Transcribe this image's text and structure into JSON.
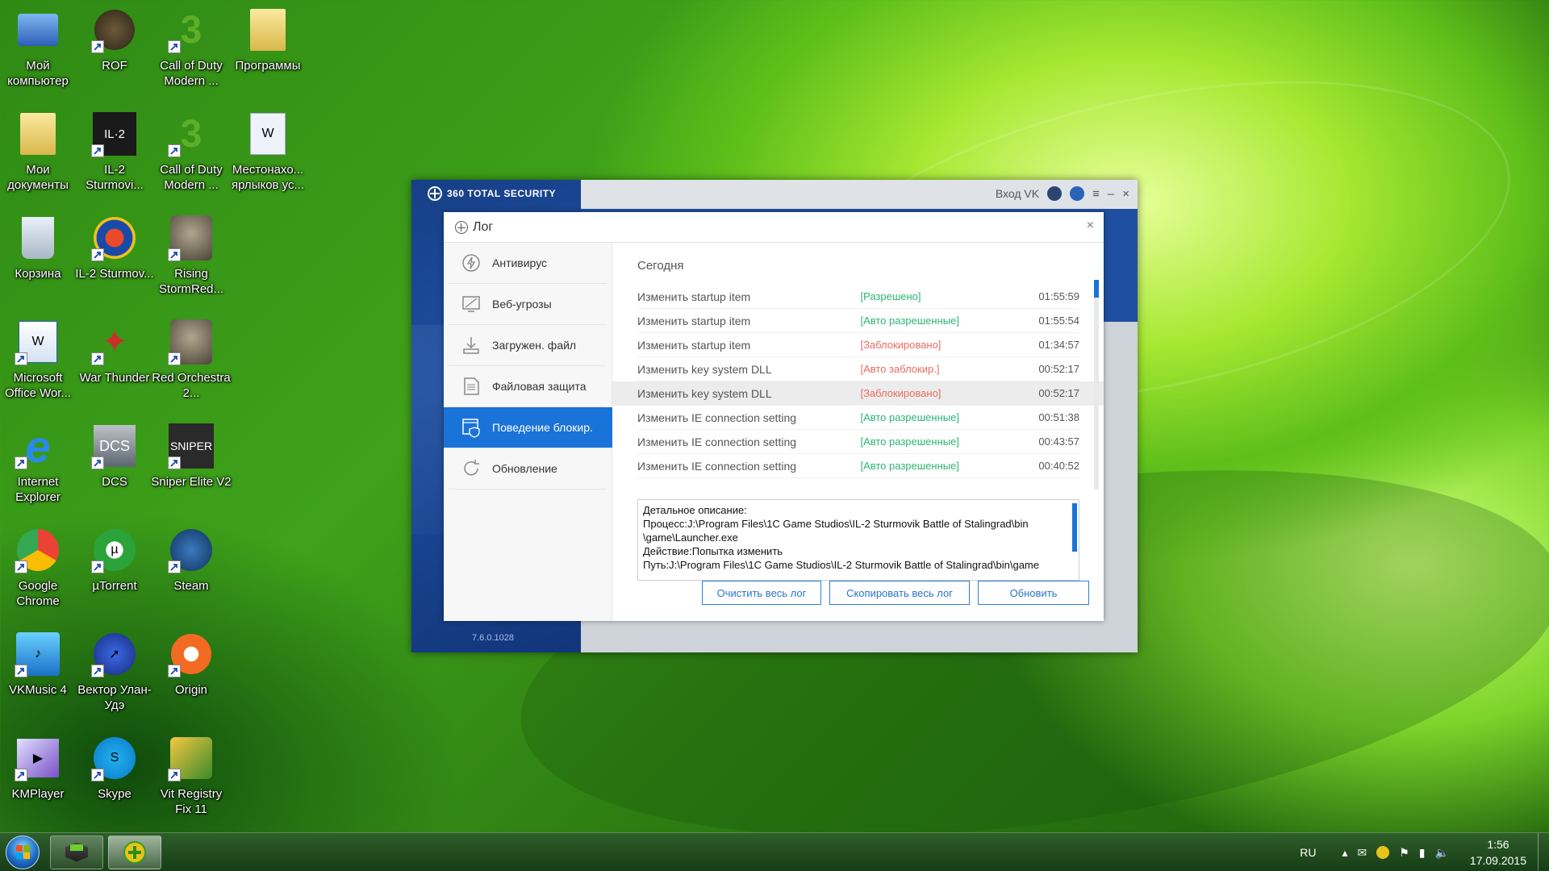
{
  "desktop": {
    "icons": [
      {
        "label": "Мой компьютер"
      },
      {
        "label": "ROF"
      },
      {
        "label": "Call of Duty Modern ..."
      },
      {
        "label": "Программы"
      },
      {
        "label": "Мои документы"
      },
      {
        "label": "IL-2 Sturmovi..."
      },
      {
        "label": "Call of Duty Modern ..."
      },
      {
        "label": "Местонахо... ярлыков ус..."
      },
      {
        "label": "Корзина"
      },
      {
        "label": "IL-2 Sturmov..."
      },
      {
        "label": "Rising StormRed..."
      },
      {
        "label": "Microsoft Office Wor..."
      },
      {
        "label": "War Thunder"
      },
      {
        "label": "Red Orchestra 2..."
      },
      {
        "label": "Internet Explorer"
      },
      {
        "label": "DCS"
      },
      {
        "label": "Sniper Elite V2"
      },
      {
        "label": "Google Chrome"
      },
      {
        "label": "µTorrent"
      },
      {
        "label": "Steam"
      },
      {
        "label": "VKMusic 4"
      },
      {
        "label": "Вектор Улан-Удэ"
      },
      {
        "label": "Origin"
      },
      {
        "label": "KMPlayer"
      },
      {
        "label": "Skype"
      },
      {
        "label": "Vit Registry Fix 11"
      }
    ]
  },
  "app": {
    "brand": "360 TOTAL SECURITY",
    "login": "Вход VK",
    "version": "7.6.0.1028",
    "dialog": {
      "title": "Лог",
      "nav": [
        {
          "label": "Антивирус"
        },
        {
          "label": "Веб-угрозы"
        },
        {
          "label": "Загружен. файл"
        },
        {
          "label": "Файловая защита"
        },
        {
          "label": "Поведение блокир."
        },
        {
          "label": "Обновление"
        }
      ],
      "active_nav": 4,
      "section_title": "Сегодня",
      "rows": [
        {
          "event": "Изменить startup item",
          "status": "[Разрешено]",
          "status_type": "ok",
          "time": "01:55:59"
        },
        {
          "event": "Изменить startup item",
          "status": "[Авто разрешенные]",
          "status_type": "ok",
          "time": "01:55:54"
        },
        {
          "event": "Изменить startup item",
          "status": "[Заблокировано]",
          "status_type": "bad",
          "time": "01:34:57"
        },
        {
          "event": "Изменить key system DLL",
          "status": "[Авто заблокир.]",
          "status_type": "bad",
          "time": "00:52:17"
        },
        {
          "event": "Изменить key system DLL",
          "status": "[Заблокировано]",
          "status_type": "bad",
          "time": "00:52:17"
        },
        {
          "event": "Изменить IE connection setting",
          "status": "[Авто разрешенные]",
          "status_type": "ok",
          "time": "00:51:38"
        },
        {
          "event": "Изменить IE connection setting",
          "status": "[Авто разрешенные]",
          "status_type": "ok",
          "time": "00:43:57"
        },
        {
          "event": "Изменить IE connection setting",
          "status": "[Авто разрешенные]",
          "status_type": "ok",
          "time": "00:40:52"
        }
      ],
      "description": {
        "line1": "Детальное описание:",
        "line2": "Процесс:J:\\Program Files\\1C Game Studios\\IL-2 Sturmovik Battle of Stalingrad\\bin",
        "line3": "\\game\\Launcher.exe",
        "line4": "Действие:Попытка изменить",
        "line5": "Путь:J:\\Program Files\\1C Game Studios\\IL-2 Sturmovik Battle of Stalingrad\\bin\\game"
      },
      "buttons": {
        "clear": "Очистить весь лог",
        "copy": "Скопировать весь лог",
        "refresh": "Обновить"
      }
    }
  },
  "taskbar": {
    "lang": "RU",
    "time": "1:56",
    "date": "17.09.2015"
  },
  "colors": {
    "accent": "#1a73d8",
    "ok": "#2bb673",
    "bad": "#ea6b61",
    "app_blue": "#1f4fa0"
  }
}
